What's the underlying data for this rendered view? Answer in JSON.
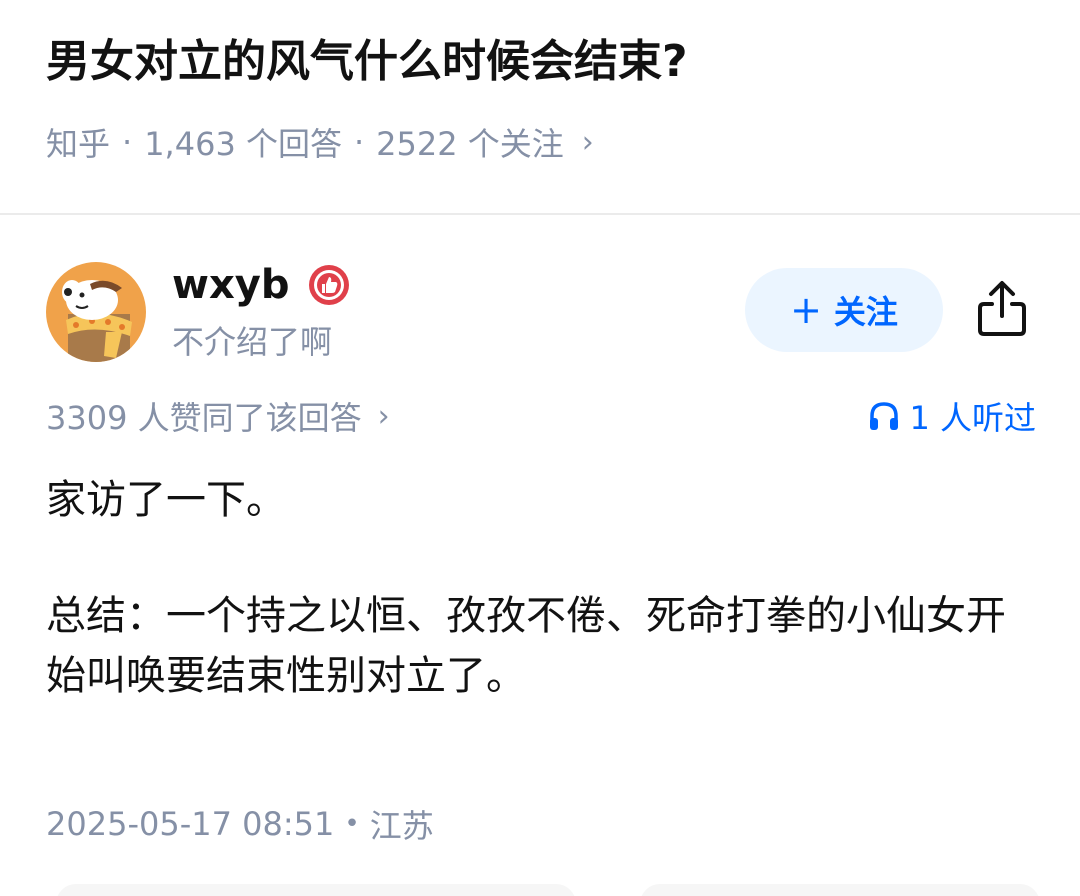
{
  "question": {
    "title": "男女对立的风气什么时候会结束?",
    "source": "知乎",
    "answers": "1,463 个回答",
    "followers": "2522 个关注",
    "sep": "·"
  },
  "author": {
    "name": "wxyb",
    "bio": "不介绍了啊",
    "follow_label": "关注",
    "follow_plus": "+"
  },
  "answer": {
    "upvotes": "3309 人赞同了该回答",
    "listeners": "1 人听过",
    "paragraphs": [
      "家访了一下。",
      "总结：一个持之以恒、孜孜不倦、死命打拳的小仙女开始叫唤要结束性别对立了。"
    ],
    "date": "2025-05-17 08:51",
    "location": "江苏",
    "location_sep": "•"
  },
  "colors": {
    "accent": "#0066ff",
    "follow_bg": "#ebf5ff",
    "meta_gray": "#8590a6",
    "text": "#121212",
    "badge_red": "#e0404a"
  },
  "icons": {
    "chevron": "›",
    "headphones": "headphones-icon",
    "share": "share-icon",
    "badge": "verified-badge-icon"
  }
}
